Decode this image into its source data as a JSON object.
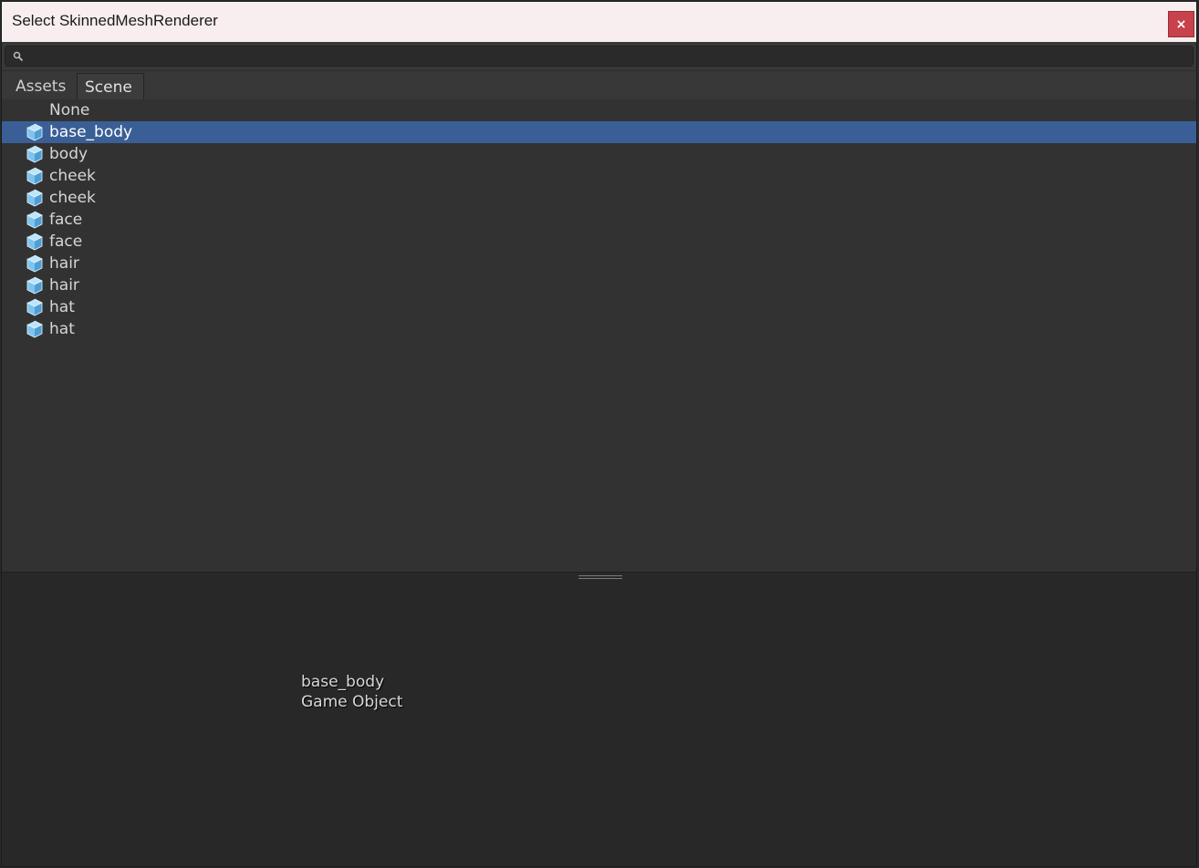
{
  "window": {
    "title": "Select SkinnedMeshRenderer",
    "close_label": "×"
  },
  "search": {
    "value": "",
    "placeholder": ""
  },
  "tabs": [
    {
      "label": "Assets",
      "active": false
    },
    {
      "label": "Scene",
      "active": true
    }
  ],
  "list": {
    "items": [
      {
        "label": "None",
        "icon": null,
        "selected": false
      },
      {
        "label": "base_body",
        "icon": "gameobject-cube-icon",
        "selected": true
      },
      {
        "label": "body",
        "icon": "gameobject-cube-icon",
        "selected": false
      },
      {
        "label": "cheek",
        "icon": "gameobject-cube-icon",
        "selected": false
      },
      {
        "label": "cheek",
        "icon": "gameobject-cube-icon",
        "selected": false
      },
      {
        "label": "face",
        "icon": "gameobject-cube-icon",
        "selected": false
      },
      {
        "label": "face",
        "icon": "gameobject-cube-icon",
        "selected": false
      },
      {
        "label": "hair",
        "icon": "gameobject-cube-icon",
        "selected": false
      },
      {
        "label": "hair",
        "icon": "gameobject-cube-icon",
        "selected": false
      },
      {
        "label": "hat",
        "icon": "gameobject-cube-icon",
        "selected": false
      },
      {
        "label": "hat",
        "icon": "gameobject-cube-icon",
        "selected": false
      }
    ]
  },
  "preview": {
    "name": "base_body",
    "type": "Game Object"
  },
  "colors": {
    "selection": "#3a5f96",
    "close_button": "#c7424c",
    "titlebar": "#f8eef0",
    "cube_icon": "#7fc4ee"
  }
}
